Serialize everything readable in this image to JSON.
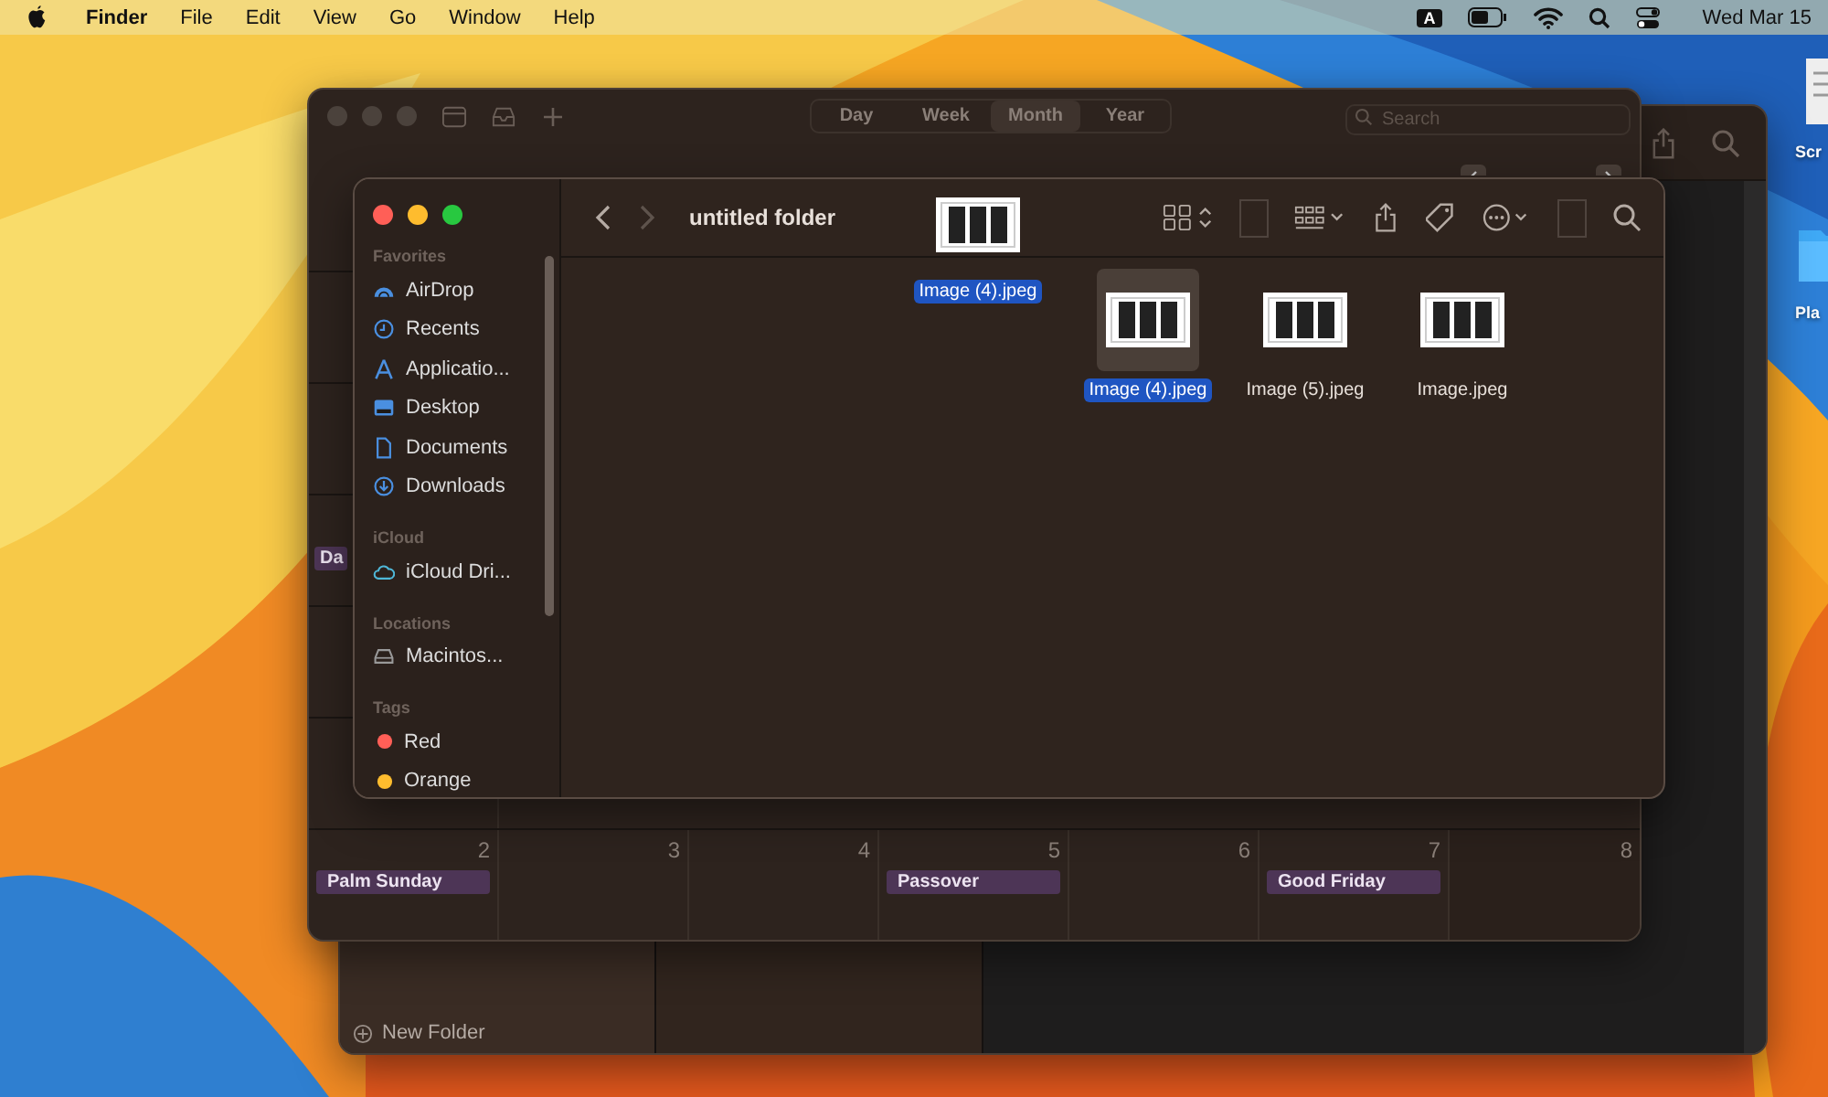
{
  "menu_bar": {
    "app": "Finder",
    "menus": [
      "File",
      "Edit",
      "View",
      "Go",
      "Window",
      "Help"
    ],
    "input_source": "A",
    "clock": "Wed Mar 15"
  },
  "desktop_icons": [
    {
      "label": "Scr",
      "kind": "document"
    },
    {
      "label": "Pla",
      "kind": "folder"
    }
  ],
  "back_window": {
    "footer_button": "New Folder"
  },
  "calendar": {
    "views": [
      {
        "label": "Day",
        "selected": false
      },
      {
        "label": "Week",
        "selected": false
      },
      {
        "label": "Month",
        "selected": true
      },
      {
        "label": "Year",
        "selected": false
      }
    ],
    "search": {
      "placeholder": "Search"
    },
    "partial_event": "Da",
    "week": [
      {
        "day": "2",
        "event": "Palm Sunday"
      },
      {
        "day": "3"
      },
      {
        "day": "4"
      },
      {
        "day": "5",
        "event": "Passover"
      },
      {
        "day": "6"
      },
      {
        "day": "7",
        "event": "Good Friday"
      },
      {
        "day": "8"
      }
    ]
  },
  "finder": {
    "title": "untitled folder",
    "sidebar": [
      {
        "heading": "Favorites",
        "items": [
          {
            "label": "AirDrop",
            "kind": "airdrop"
          },
          {
            "label": "Recents",
            "kind": "clock"
          },
          {
            "label": "Applicatio...",
            "kind": "apps"
          },
          {
            "label": "Desktop",
            "kind": "desktop"
          },
          {
            "label": "Documents",
            "kind": "document"
          },
          {
            "label": "Downloads",
            "kind": "download"
          }
        ]
      },
      {
        "heading": "iCloud",
        "items": [
          {
            "label": "iCloud Dri...",
            "kind": "cloud"
          }
        ]
      },
      {
        "heading": "Locations",
        "items": [
          {
            "label": "Macintos...",
            "kind": "disk"
          }
        ]
      },
      {
        "heading": "Tags",
        "items": [
          {
            "label": "Red",
            "kind": "tag",
            "color": "#ff5f57"
          },
          {
            "label": "Orange",
            "kind": "tag",
            "color": "#febc2e"
          }
        ]
      }
    ],
    "dragged": {
      "name": "Image (4).jpeg"
    },
    "files": [
      {
        "name": "Image (4).jpeg",
        "selected": true
      },
      {
        "name": "Image (5).jpeg",
        "selected": false
      },
      {
        "name": "Image.jpeg",
        "selected": false
      }
    ]
  }
}
